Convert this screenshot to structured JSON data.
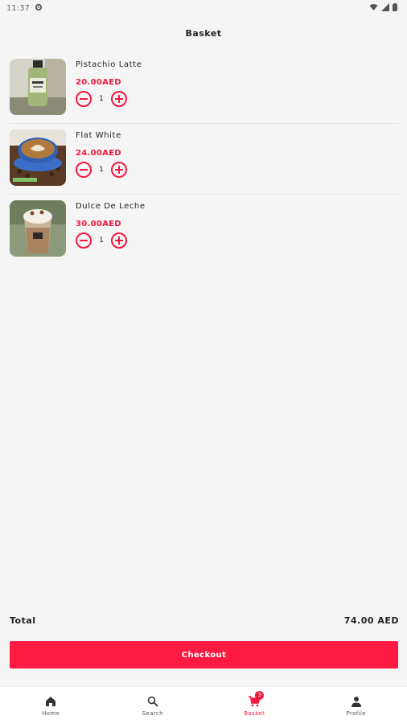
{
  "status_bar": {
    "time": "11:37",
    "icons": [
      "settings-gear-icon",
      "wifi-icon",
      "signal-icon",
      "battery-icon"
    ]
  },
  "header": {
    "title": "Basket"
  },
  "basket": {
    "items": [
      {
        "name": "Pistachio Latte",
        "price": "20.00AED",
        "quantity": "1",
        "image": "pistachio-latte-bottle-photo"
      },
      {
        "name": "Flat White",
        "price": "24.00AED",
        "quantity": "1",
        "image": "flat-white-cup-photo"
      },
      {
        "name": "Dulce De Leche",
        "price": "30.00AED",
        "quantity": "1",
        "image": "dulce-de-leche-cup-photo"
      }
    ]
  },
  "summary": {
    "total_label": "Total",
    "total_value": "74.00 AED"
  },
  "checkout": {
    "label": "Checkout"
  },
  "bottom_nav": {
    "items": [
      {
        "label": "Home",
        "icon": "home-icon",
        "active": false
      },
      {
        "label": "Search",
        "icon": "search-icon",
        "active": false
      },
      {
        "label": "Basket",
        "icon": "cart-icon",
        "active": true,
        "badge": "3"
      },
      {
        "label": "Profile",
        "icon": "person-icon",
        "active": false
      }
    ]
  },
  "colors": {
    "accent": "#f2193f",
    "checkout": "#fe1a41",
    "background": "#f5f5f5"
  }
}
